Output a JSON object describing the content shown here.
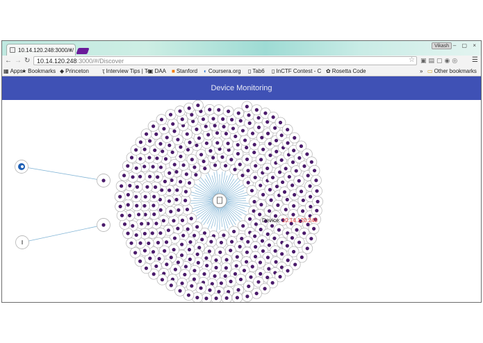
{
  "browser": {
    "tab_title": "10.14.120.248:3000/#/",
    "tab_close": "×",
    "user": "Vikash",
    "window_controls": "– ▢ ×",
    "url_host": "10.14.120.248",
    "url_path": ":3000/#/Discover"
  },
  "bookmarks": {
    "items": [
      {
        "label": "Apps",
        "icon": "apps-grid-icon"
      },
      {
        "label": "Bookmarks",
        "icon": "star-icon"
      },
      {
        "label": "Princeton",
        "icon": "princeton-icon"
      },
      {
        "label": "Interview Tips | Te",
        "icon": "interview-icon"
      },
      {
        "label": "DAA",
        "icon": "daa-icon"
      },
      {
        "label": "Stanford",
        "icon": "blogger-icon"
      },
      {
        "label": "Coursera.org",
        "icon": "coursera-icon"
      },
      {
        "label": "Tab6",
        "icon": "page-icon"
      },
      {
        "label": "InCTF Contest - C",
        "icon": "page-icon"
      },
      {
        "label": "Rosetta Code",
        "icon": "rosetta-icon"
      }
    ],
    "overflow": "»",
    "other": "Other bookmarks"
  },
  "app": {
    "title": "Device Monitoring",
    "hover_label_prefix": "Device:",
    "hover_label_ip": "10.14.120.248",
    "colors": {
      "header": "#3f51b5",
      "node_dot": "#4a1a6b",
      "node_ring": "#bbbbbb",
      "link": "#7fb3d5",
      "hover_ip": "#e53935"
    }
  }
}
